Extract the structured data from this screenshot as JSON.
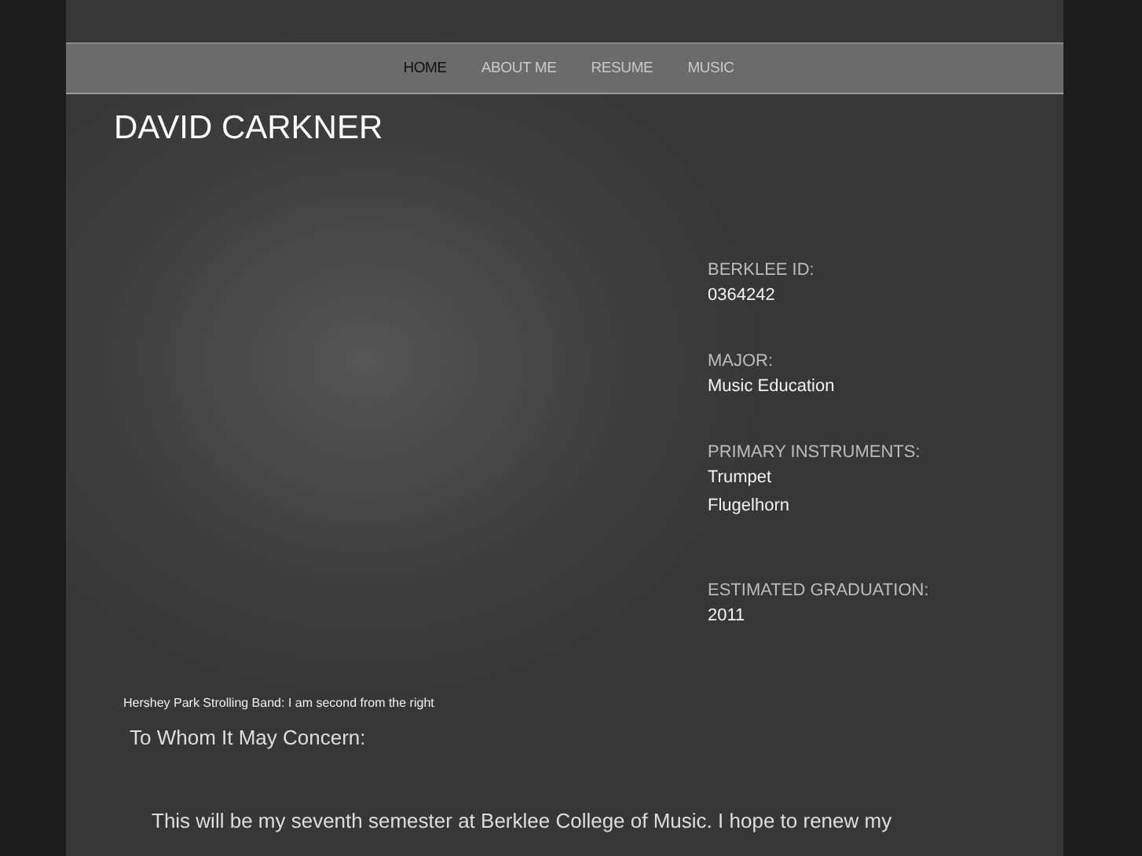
{
  "nav": [
    {
      "label": "HOME",
      "selected": true
    },
    {
      "label": "ABOUT ME",
      "selected": false
    },
    {
      "label": "RESUME",
      "selected": false
    },
    {
      "label": "MUSIC",
      "selected": false
    }
  ],
  "site_title": "DAVID CARKNER",
  "photo_caption": "Hershey Park Strolling Band: I am second from the right",
  "facts": [
    {
      "label": "BERKLEE ID:",
      "values": [
        "0364242"
      ]
    },
    {
      "label": "MAJOR:",
      "values": [
        "Music Education"
      ]
    },
    {
      "label": "PRIMARY INSTRUMENTS:",
      "values": [
        "Trumpet",
        "Flugelhorn"
      ]
    },
    {
      "label": "ESTIMATED GRADUATION:",
      "values": [
        "2011"
      ]
    }
  ],
  "letter": {
    "greeting": "To Whom It May Concern:",
    "paragraph": "This will be my seventh semester at Berklee College of Music.  I hope to renew my"
  }
}
